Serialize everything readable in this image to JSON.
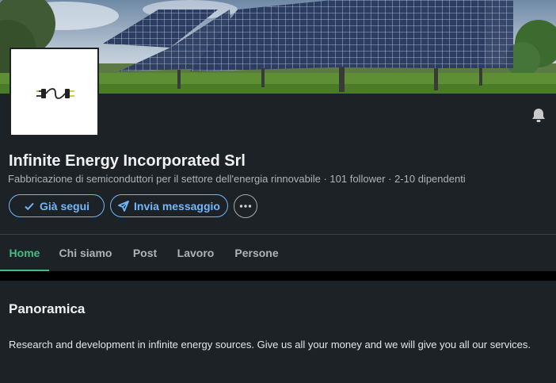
{
  "company": {
    "name": "Infinite Energy Incorporated Srl",
    "meta": "Fabbricazione di semiconduttori per il settore dell'energia rinnovabile · 101 follower · 2-10 dipendenti"
  },
  "actions": {
    "follow_label": "Già segui",
    "message_label": "Invia messaggio",
    "more_icon": "more-horizontal-icon"
  },
  "notification_icon": "bell-icon",
  "tabs": [
    {
      "label": "Home",
      "active": true
    },
    {
      "label": "Chi siamo",
      "active": false
    },
    {
      "label": "Post",
      "active": false
    },
    {
      "label": "Lavoro",
      "active": false
    },
    {
      "label": "Persone",
      "active": false
    }
  ],
  "overview": {
    "title": "Panoramica",
    "text": "Research and development in infinite energy sources. Give us all your money and we will give you all our services."
  },
  "colors": {
    "accent_blue": "#71b7fb",
    "accent_green": "#3fbf86",
    "card_bg": "#1d2226"
  }
}
